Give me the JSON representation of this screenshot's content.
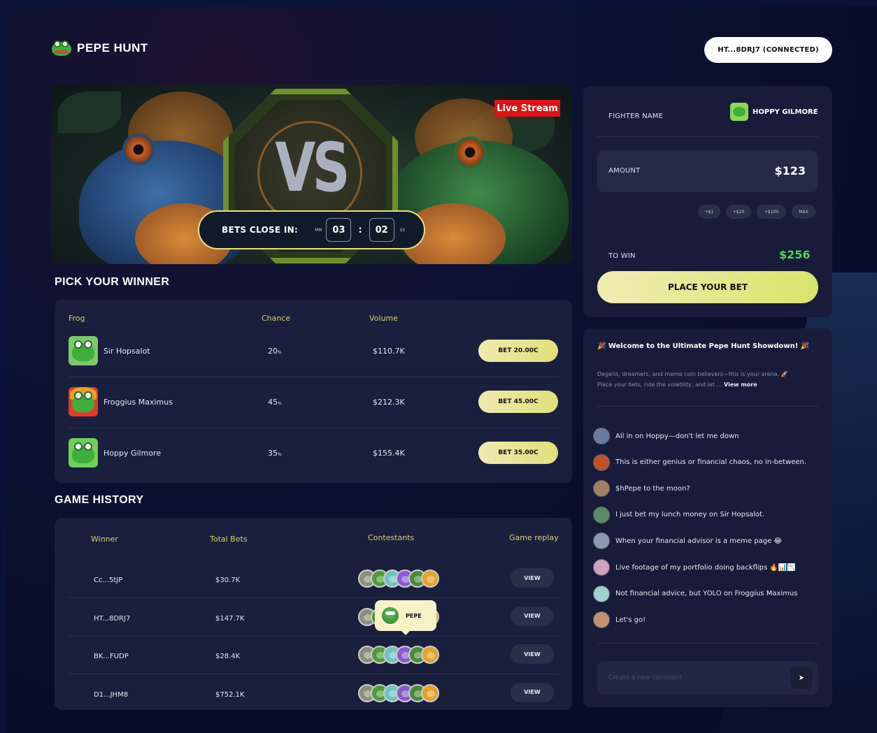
{
  "header": {
    "brand": "PEPE HUNT",
    "wallet_label": "HT...8DRJ7 (CONNECTED)"
  },
  "hero": {
    "vs_text": "VS",
    "live_label": "Live Stream",
    "timer_label": "BETS CLOSE IN:",
    "minutes_unit": "MM",
    "seconds_unit": "SS",
    "minutes": "03",
    "seconds": "02"
  },
  "pick": {
    "title": "PICK YOUR WINNER",
    "columns": [
      "Frog",
      "Chance",
      "Volume"
    ],
    "rows": [
      {
        "name": "Sir Hopsalot",
        "chance": "20",
        "volume": "$110.7K",
        "bet_label": "BET 20.00C",
        "avatar_color": "#7cc86a"
      },
      {
        "name": "Froggius Maximus",
        "chance": "45",
        "volume": "$212.3K",
        "bet_label": "BET 45.00C",
        "avatar_color": "#e33b2a"
      },
      {
        "name": "Hoppy Gilmore",
        "chance": "35",
        "volume": "$155.4K",
        "bet_label": "BET 35.00C",
        "avatar_color": "#6fcf5a"
      }
    ],
    "percent_sign": "%"
  },
  "history": {
    "title": "GAME HISTORY",
    "columns": [
      "Winner",
      "Total Bets",
      "Contestants",
      "Game replay"
    ],
    "rows": [
      {
        "winner": "Cc...5tJP",
        "total": "$30.7K",
        "view": "VIEW"
      },
      {
        "winner": "HT...8DRJ7",
        "total": "$147.7K",
        "view": "VIEW"
      },
      {
        "winner": "BK...FUDP",
        "total": "$28.4K",
        "view": "VIEW"
      },
      {
        "winner": "D1...JHM8",
        "total": "$752.1K",
        "view": "VIEW"
      }
    ],
    "contestant_colors": [
      "#8a8f7a",
      "#4f9a3a",
      "#6fc2c0",
      "#8a5ad0",
      "#4a8a3a",
      "#e3a22a"
    ],
    "tooltip_label": "PEPE"
  },
  "bet_slip": {
    "fighter_label": "FIGHTER NAME",
    "fighter_name": "HOPPY GILMORE",
    "amount_label": "AMOUNT",
    "amount_value": "$123",
    "quick_amounts": [
      "+$1",
      "+$20",
      "+$100",
      "MAX"
    ],
    "to_win_label": "TO WIN",
    "to_win_value": "$256",
    "place_label": "PLACE YOUR BET"
  },
  "chat": {
    "welcome": "🎉 Welcome to the Ultimate Pepe Hunt Showdown! 🎉",
    "intro_line1": "Degens, dreamers, and meme coin believers—this is your arena. 🚀",
    "intro_line2": "Place your bets, ride the volatility, and let",
    "view_more": "View more",
    "messages": [
      {
        "text": "All in on Hoppy—don't let me down",
        "avatar_color": "#6a7aa0"
      },
      {
        "text": "This is either genius or financial chaos, no in-between.",
        "avatar_color": "#c0502a"
      },
      {
        "text": "$hPepe to the moon?",
        "avatar_color": "#a08060"
      },
      {
        "text": "I just bet my lunch money on Sir Hopsalot.",
        "avatar_color": "#5a8a6a"
      },
      {
        "text": "When your financial advisor is a meme page 😂",
        "avatar_color": "#8a9ab0"
      },
      {
        "text": "Live footage of my portfolio doing backflips 🔥📊📉",
        "avatar_color": "#d0a0c0"
      },
      {
        "text": "Not financial advice, but YOLO on Froggius Maximus",
        "avatar_color": "#a0d0d0"
      },
      {
        "text": "Let's go!",
        "avatar_color": "#c09070"
      }
    ],
    "comment_placeholder": "Create a new comment",
    "send_icon": "send-icon"
  }
}
